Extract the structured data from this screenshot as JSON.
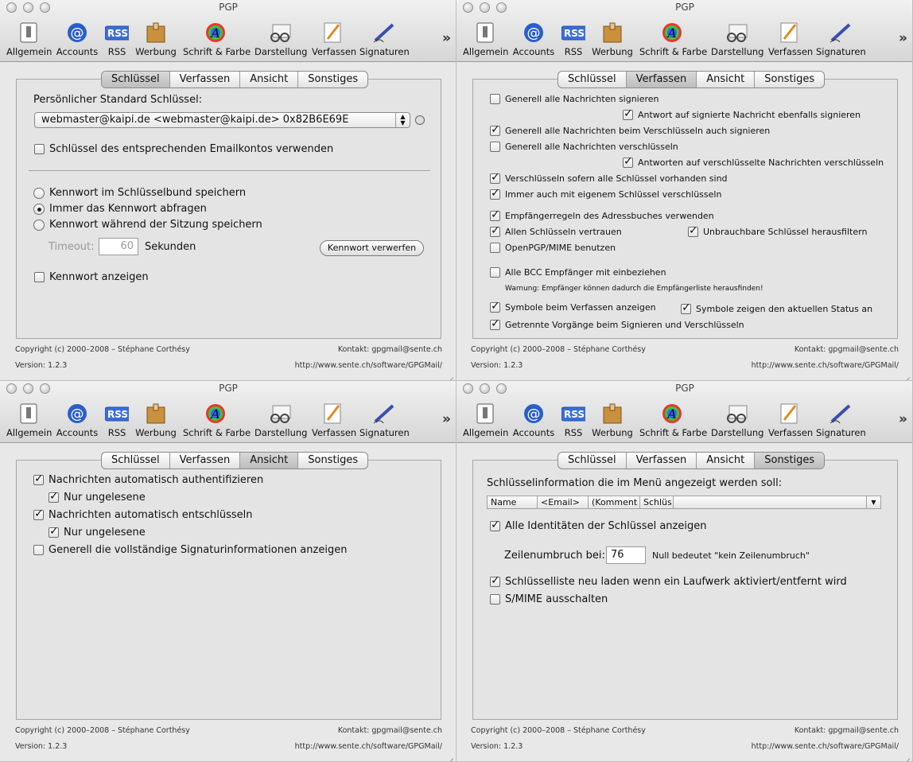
{
  "window_title": "PGP",
  "toolbar": {
    "items": [
      "Allgemein",
      "Accounts",
      "RSS",
      "Werbung",
      "Schrift & Farbe",
      "Darstellung",
      "Verfassen",
      "Signaturen"
    ],
    "rss_badge": "RSS",
    "overflow": "»"
  },
  "tabs": [
    "Schlüssel",
    "Verfassen",
    "Ansicht",
    "Sonstiges"
  ],
  "footer": {
    "copyright": "Copyright (c) 2000–2008 – Stéphane Corthésy",
    "version": "Version: 1.2.3",
    "contact": "Kontakt: gpgmail@sente.ch",
    "url": "http://www.sente.ch/software/GPGMail/"
  },
  "schluessel": {
    "label_default_key": "Persönlicher Standard Schlüssel:",
    "default_key_value": "webmaster@kaipi.de <webmaster@kaipi.de> 0x82B6E69E",
    "use_account_key": "Schlüssel des entsprechenden Emailkontos verwenden",
    "radio_keychain": "Kennwort im Schlüsselbund speichern",
    "radio_always_ask": "Immer das Kennwort abfragen",
    "radio_session": "Kennwort während der Sitzung speichern",
    "timeout_label": "Timeout:",
    "timeout_value": "60",
    "seconds_label": "Sekunden",
    "discard_button": "Kennwort verwerfen",
    "show_password": "Kennwort anzeigen"
  },
  "verfassen": {
    "sign_all": "Generell alle Nachrichten signieren",
    "reply_signed": "Antwort auf signierte Nachricht ebenfalls signieren",
    "sign_when_encrypt": "Generell alle Nachrichten beim Verschlüsseln auch signieren",
    "encrypt_all": "Generell alle Nachrichten verschlüsseln",
    "reply_encrypted": "Antworten auf verschlüsselte Nachrichten verschlüsseln",
    "encrypt_if_keys": "Verschlüsseln sofern alle Schlüssel vorhanden sind",
    "encrypt_own_key": "Immer auch mit eigenem Schlüssel verschlüsseln",
    "recipient_rules": "Empfängerregeln des Adressbuches verwenden",
    "trust_all": "Allen Schlüsseln vertrauen",
    "filter_unusable": "Unbrauchbare Schlüssel herausfiltern",
    "openpgp_mime": "OpenPGP/MIME benutzen",
    "include_bcc": "Alle BCC Empfänger mit einbeziehen",
    "bcc_warning": "Warnung: Empfänger können dadurch die Empfängerliste herausfinden!",
    "show_symbols": "Symbole beim Verfassen anzeigen",
    "symbols_status": "Symbole zeigen den aktuellen Status an",
    "separate_ops": "Getrennte Vorgänge beim Signieren und Verschlüsseln"
  },
  "ansicht": {
    "auto_auth": "Nachrichten automatisch authentifizieren",
    "only_unread_1": "Nur ungelesene",
    "auto_decrypt": "Nachrichten automatisch entschlüsseln",
    "only_unread_2": "Nur ungelesene",
    "full_sig_info": "Generell die vollständige Signaturinformationen anzeigen"
  },
  "sonstiges": {
    "key_info_label": "Schlüsselinformation die im Menü angezeigt werden soll:",
    "columns": [
      "Name",
      "<Email>",
      "(Komment",
      "Schlüs"
    ],
    "show_all_ids": "Alle Identitäten der Schlüssel anzeigen",
    "line_wrap_label": "Zeilenumbruch bei:",
    "line_wrap_value": "76",
    "line_wrap_hint": "Null bedeutet \"kein Zeilenumbruch\"",
    "reload_keys": "Schlüsselliste neu laden wenn ein Laufwerk aktiviert/entfernt wird",
    "disable_smime": "S/MIME ausschalten"
  }
}
